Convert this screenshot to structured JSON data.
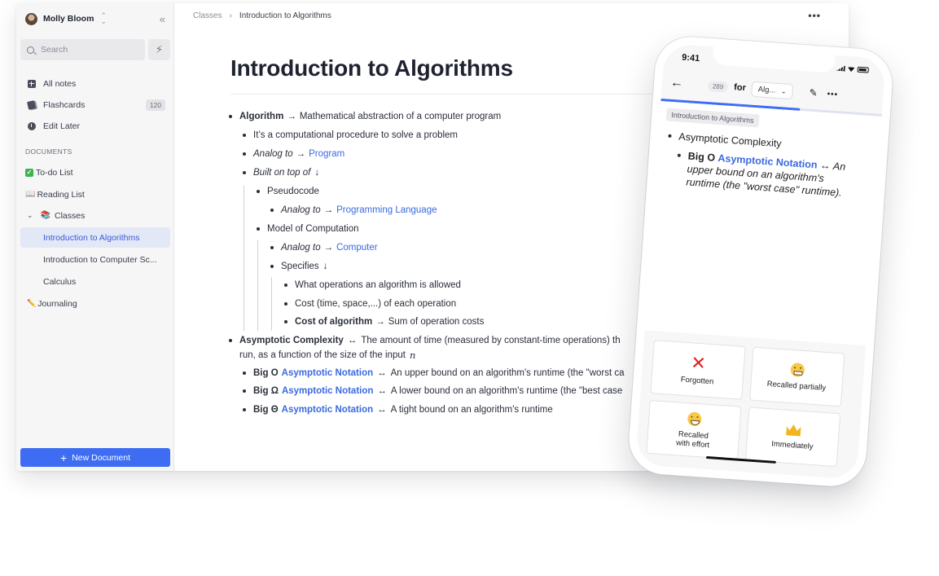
{
  "sidebar": {
    "user_name": "Molly Bloom",
    "search_placeholder": "Search",
    "nav": [
      {
        "label": "All notes",
        "icon": "grid-icon"
      },
      {
        "label": "Flashcards",
        "icon": "cards-icon",
        "badge": "120"
      },
      {
        "label": "Edit Later",
        "icon": "clock-icon"
      }
    ],
    "section_label": "DOCUMENTS",
    "docs": {
      "todo": "To-do List",
      "reading": "Reading List",
      "classes": "Classes",
      "intro_algorithms": "Introduction to Algorithms",
      "intro_cs": "Introduction to Computer Sc...",
      "calculus": "Calculus",
      "journaling": "Journaling"
    },
    "new_document": "New Document"
  },
  "breadcrumb": {
    "parent": "Classes",
    "current": "Introduction to Algorithms"
  },
  "document": {
    "title": "Introduction to Algorithms",
    "lines": {
      "l1_term": "Algorithm",
      "l1_text": "Mathematical abstraction of a computer program",
      "l2": "It’s a computational procedure to solve a problem",
      "l3_pre": "Analog to",
      "l3_link": "Program",
      "l4": "Built on top of",
      "l5": "Pseudocode",
      "l6_pre": "Analog to",
      "l6_link": "Programming Language",
      "l7": "Model of Computation",
      "l8_pre": "Analog to",
      "l8_link": "Computer",
      "l9": "Specifies",
      "l10": "What operations an algorithm is allowed",
      "l11": "Cost (time, space,...) of each operation",
      "l12_term": "Cost of algorithm",
      "l12_text": "Sum of operation costs",
      "l13_term": "Asymptotic Complexity",
      "l13_text": "The amount of time (measured by constant-time operations) th",
      "l13_cont": "run, as a function of the size of the input",
      "l13_var": "n",
      "l14_term": "Big O",
      "l14_link": "Asymptotic Notation",
      "l14_text": "An upper bound on an algorithm's runtime (the \"worst ca",
      "l15_term": "Big Ω",
      "l15_link": "Asymptotic Notation",
      "l15_text": "A lower bound on an algorithm's runtime (the \"best case",
      "l16_term": "Big Θ",
      "l16_link": "Asymptotic Notation",
      "l16_text": "A tight bound on an algorithm's runtime"
    }
  },
  "phone": {
    "time": "9:41",
    "count": "289",
    "for_label": "for",
    "deck": "Alg...",
    "progress": 0.63,
    "tag": "Introduction to Algorithms",
    "card_heading": "Asymptotic Complexity",
    "card_term": "Big O",
    "card_link": "Asymptotic Notation",
    "card_text": "An upper bound on an algorithm's runtime (the \"worst case\" runtime).",
    "grades": {
      "forgotten": "Forgotten",
      "partial": "Recalled partially",
      "effort_1": "Recalled",
      "effort_2": "with effort",
      "immediately": "Immediately"
    }
  }
}
